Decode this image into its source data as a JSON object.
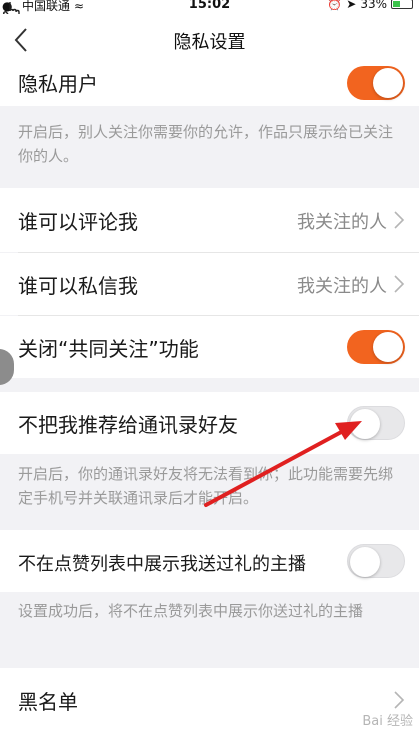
{
  "status_bar": {
    "carrier": "中国联通",
    "time": "15:02",
    "battery": "33%"
  },
  "nav": {
    "title": "隐私设置"
  },
  "rows": {
    "private_user": {
      "label": "隐私用户",
      "toggle": "on"
    },
    "private_user_note": "开启后，别人关注你需要你的允许，作品只展示给已关注你的人。",
    "who_comment": {
      "label": "谁可以评论我",
      "value": "我关注的人"
    },
    "who_message": {
      "label": "谁可以私信我",
      "value": "我关注的人"
    },
    "close_mutual": {
      "label": "关闭“共同关注”功能",
      "toggle": "on"
    },
    "no_recommend_contacts": {
      "label": "不把我推荐给通讯录好友",
      "toggle": "off"
    },
    "no_recommend_note": "开启后，你的通讯录好友将无法看到你；此功能需要先绑定手机号并关联通讯录后才能开启。",
    "no_gift_list": {
      "label": "不在点赞列表中展示我送过礼的主播",
      "toggle": "off"
    },
    "no_gift_note": "设置成功后，将不在点赞列表中展示你送过礼的主播",
    "blacklist": {
      "label": "黑名单"
    }
  },
  "colors": {
    "accent": "#f2641f",
    "annotation_arrow": "#e02020"
  },
  "watermark": "Bai 经验"
}
